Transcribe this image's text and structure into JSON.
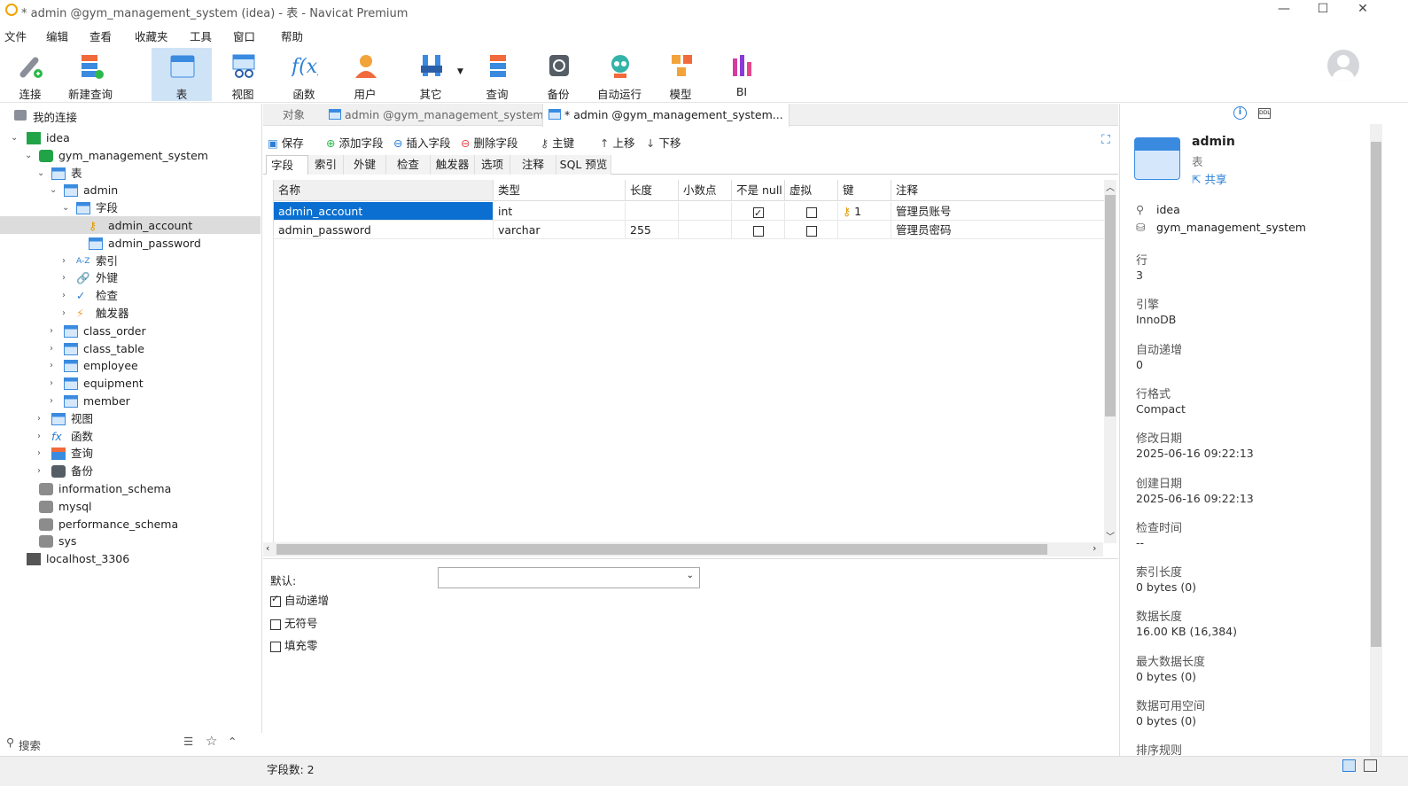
{
  "window": {
    "title": "* admin @gym_management_system (idea) - 表 - Navicat Premium",
    "min": "—",
    "max": "☐",
    "close": "✕"
  },
  "menu": [
    "文件",
    "编辑",
    "查看",
    "收藏夹",
    "工具",
    "窗口",
    "帮助"
  ],
  "toolbar": [
    {
      "label": "连接",
      "icon": "connect-icon"
    },
    {
      "label": "新建查询",
      "icon": "new-query-icon"
    },
    {
      "label": "表",
      "icon": "table-icon"
    },
    {
      "label": "视图",
      "icon": "view-icon"
    },
    {
      "label": "函数",
      "icon": "function-icon"
    },
    {
      "label": "用户",
      "icon": "user-icon"
    },
    {
      "label": "其它",
      "icon": "tools-icon"
    },
    {
      "label": "查询",
      "icon": "query-icon"
    },
    {
      "label": "备份",
      "icon": "backup-icon"
    },
    {
      "label": "自动运行",
      "icon": "robot-icon"
    },
    {
      "label": "模型",
      "icon": "model-icon"
    },
    {
      "label": "BI",
      "icon": "bi-icon"
    }
  ],
  "tree": {
    "header": "我的连接",
    "nodes": [
      {
        "label": "idea",
        "level": 0
      },
      {
        "label": "gym_management_system",
        "level": 1
      },
      {
        "label": "表",
        "level": 2
      },
      {
        "label": "admin",
        "level": 3
      },
      {
        "label": "字段",
        "level": 4
      },
      {
        "label": "admin_account",
        "level": 5
      },
      {
        "label": "admin_password",
        "level": 5
      },
      {
        "label": "索引",
        "level": 4,
        "prefix": "A-Z"
      },
      {
        "label": "外键",
        "level": 4
      },
      {
        "label": "检查",
        "level": 4
      },
      {
        "label": "触发器",
        "level": 4
      },
      {
        "label": "class_order",
        "level": 3
      },
      {
        "label": "class_table",
        "level": 3
      },
      {
        "label": "employee",
        "level": 3
      },
      {
        "label": "equipment",
        "level": 3
      },
      {
        "label": "member",
        "level": 3
      },
      {
        "label": "视图",
        "level": 2
      },
      {
        "label": "函数",
        "level": 2
      },
      {
        "label": "查询",
        "level": 2
      },
      {
        "label": "备份",
        "level": 2
      },
      {
        "label": "information_schema",
        "level": 1
      },
      {
        "label": "mysql",
        "level": 1
      },
      {
        "label": "performance_schema",
        "level": 1
      },
      {
        "label": "sys",
        "level": 1
      },
      {
        "label": "localhost_3306",
        "level": 0
      }
    ],
    "search_placeholder": "搜索"
  },
  "tabs": [
    "对象",
    "admin @gym_management_system (...",
    "* admin @gym_management_system..."
  ],
  "subtoolbar": [
    "保存",
    "添加字段",
    "插入字段",
    "删除字段",
    "主键",
    "上移",
    "下移"
  ],
  "subtabs": [
    "字段",
    "索引",
    "外键",
    "检查",
    "触发器",
    "选项",
    "注释",
    "SQL 预览"
  ],
  "grid": {
    "headers": [
      "名称",
      "类型",
      "长度",
      "小数点",
      "不是 null",
      "虚拟",
      "键",
      "注释"
    ],
    "rows": [
      {
        "name": "admin_account",
        "type": "int",
        "length": "",
        "decimals": "",
        "notnull": true,
        "virtual": false,
        "key": "1",
        "comment": "管理员账号"
      },
      {
        "name": "admin_password",
        "type": "varchar",
        "length": "255",
        "decimals": "",
        "notnull": false,
        "virtual": false,
        "key": "",
        "comment": "管理员密码"
      }
    ]
  },
  "props": {
    "default_label": "默认:",
    "auto_increment": "自动递增",
    "unsigned": "无符号",
    "zerofill": "填充零"
  },
  "info": {
    "title": "admin",
    "subtitle": "表",
    "share": "共享",
    "connection": "idea",
    "database": "gym_management_system",
    "fields": [
      {
        "label": "行",
        "value": "3"
      },
      {
        "label": "引擎",
        "value": "InnoDB"
      },
      {
        "label": "自动递增",
        "value": "0"
      },
      {
        "label": "行格式",
        "value": "Compact"
      },
      {
        "label": "修改日期",
        "value": "2025-06-16 09:22:13"
      },
      {
        "label": "创建日期",
        "value": "2025-06-16 09:22:13"
      },
      {
        "label": "检查时间",
        "value": "--"
      },
      {
        "label": "索引长度",
        "value": "0 bytes (0)"
      },
      {
        "label": "数据长度",
        "value": "16.00 KB (16,384)"
      },
      {
        "label": "最大数据长度",
        "value": "0 bytes (0)"
      },
      {
        "label": "数据可用空间",
        "value": "0 bytes (0)"
      },
      {
        "label": "排序规则",
        "value": ""
      }
    ]
  },
  "status": {
    "field_count": "字段数: 2"
  }
}
